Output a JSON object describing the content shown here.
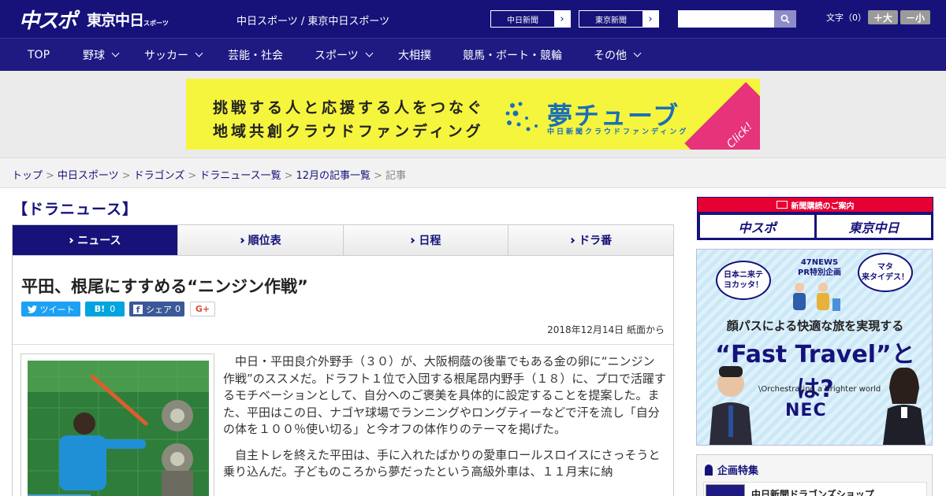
{
  "header": {
    "logo_chuspo": "中スポ",
    "logo_tokyo": "東京中日",
    "logo_tokyo_small": "スポーツ",
    "site_title": "中日スポーツ / 東京中日スポーツ",
    "links": [
      {
        "label": "中日新聞"
      },
      {
        "label": "東京新聞"
      }
    ],
    "search": {
      "placeholder": "",
      "value": ""
    },
    "fontsize_label": "文字（0）",
    "fontsize_plus": "＋大",
    "fontsize_minus": "－小"
  },
  "nav": {
    "items": [
      {
        "label": "TOP",
        "has_menu": false
      },
      {
        "label": "野球",
        "has_menu": true
      },
      {
        "label": "サッカー",
        "has_menu": true
      },
      {
        "label": "芸能・社会",
        "has_menu": false
      },
      {
        "label": "スポーツ",
        "has_menu": true
      },
      {
        "label": "大相撲",
        "has_menu": false
      },
      {
        "label": "競馬・ボート・競輪",
        "has_menu": false
      },
      {
        "label": "その他",
        "has_menu": true
      }
    ]
  },
  "ad_banner": {
    "line1": "挑戦する人と応援する人をつなぐ",
    "line2": "地域共創クラウドファンディング",
    "logo": "夢チューブ",
    "sub": "中日新聞クラウドファンディング",
    "click": "Click!",
    "bg_color": "#f6f53e",
    "accent_color": "#1a6fb8"
  },
  "breadcrumb": {
    "items": [
      "トップ",
      "中日スポーツ",
      "ドラゴンズ",
      "ドラニュース一覧",
      "12月の記事一覧"
    ],
    "current": "記事",
    "separator": ">"
  },
  "section": {
    "heading": "【ドラニュース】"
  },
  "tabs": [
    {
      "label": "ニュース",
      "active": true
    },
    {
      "label": "順位表",
      "active": false
    },
    {
      "label": "日程",
      "active": false
    },
    {
      "label": "ドラ番",
      "active": false
    }
  ],
  "article": {
    "headline": "平田、根尾にすすめる“ニンジン作戦”",
    "share": {
      "tweet_label": "ツイート",
      "hatena_label": "B!",
      "hatena_count": "0",
      "facebook_label": "シェア",
      "facebook_count": "0",
      "gplus_label": "G+"
    },
    "dateline": "2018年12月14日 紙面から",
    "paragraphs": [
      "中日・平田良介外野手（３０）が、大阪桐蔭の後輩でもある金の卵に“ニンジン作戦”のススメだ。ドラフト１位で入団する根尾昂内野手（１８）に、プロで活躍するモチベーションとして、自分へのご褒美を具体的に設定することを提案した。また、平田はこの日、ナゴヤ球場でランニングやロングティーなどで汗を流し「自分の体を１００％使い切る」と今オフの体作りのテーマを掲げた。",
      "自主トレを終えた平田は、手に入れたばかりの愛車ロールスロイスにさっそうと乗り込んだ。子どものころから夢だったという高級外車は、１１月末に納"
    ]
  },
  "sidebar": {
    "subscribe_head": "新聞購読のご案内",
    "subscribe_chuspo": "中スポ",
    "subscribe_tokyo": "東京中日",
    "ad": {
      "bubble_left": "日本ニ来テ\nヨカッタ！",
      "bubble_right": "マタ\n来タイデス！",
      "pr_line1": "47NEWS",
      "pr_line2": "PR特別企画",
      "tagline": "顔パスによる快適な旅を実現する",
      "headline": "“Fast Travel”とは?",
      "orchestrating": "\\Orchestrating a brighter world",
      "brand": "NEC"
    },
    "feature_title": "企画特集",
    "feature_item": "中日新聞ドラゴンズショップ"
  },
  "colors": {
    "brand_navy": "#16127a",
    "nav_bg": "#1e1a82",
    "accent_red": "#e60033"
  }
}
